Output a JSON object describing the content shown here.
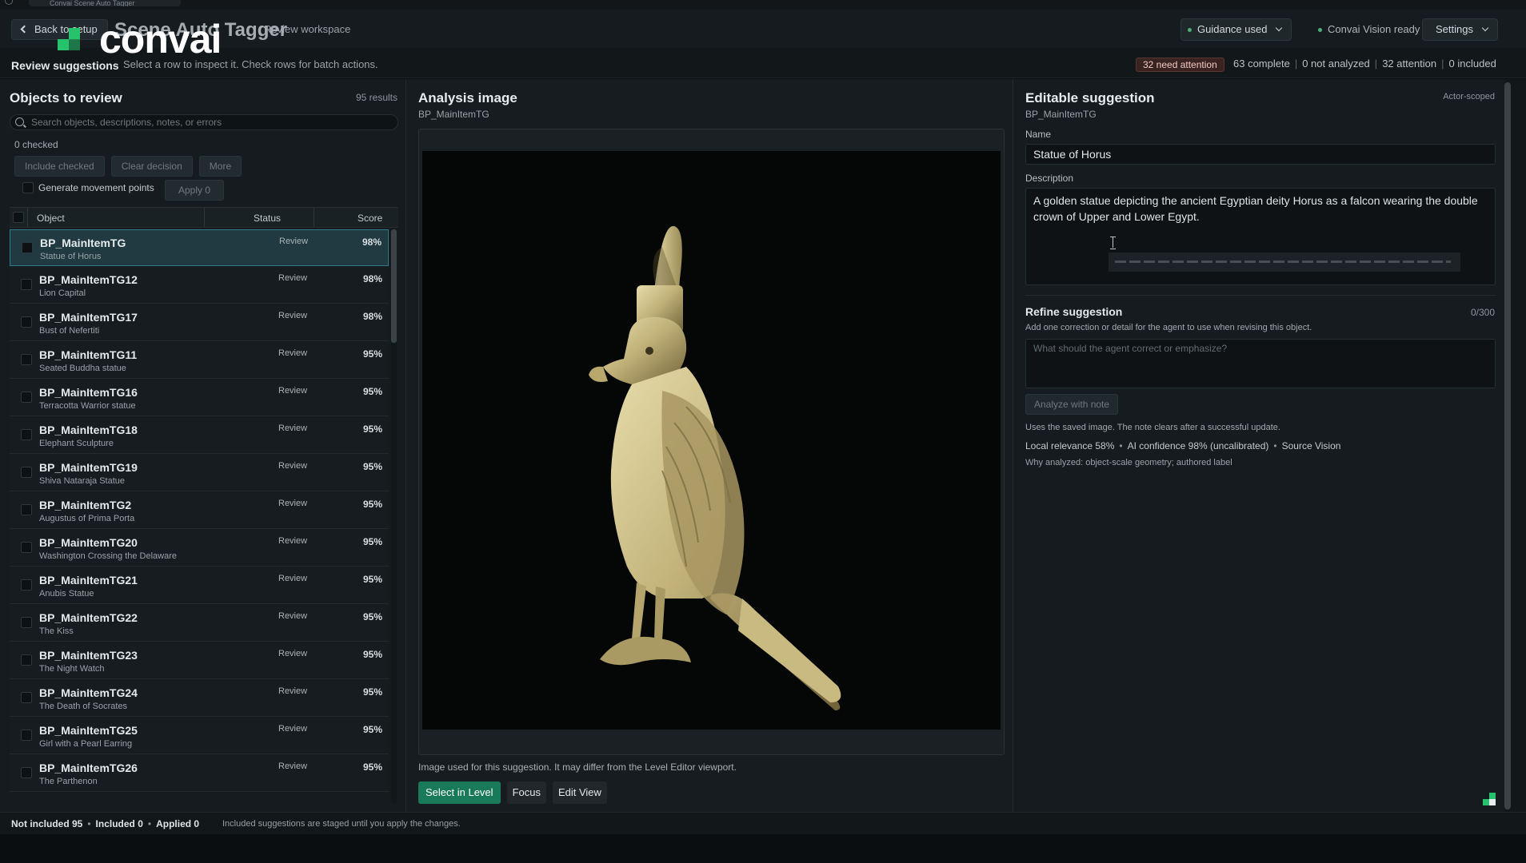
{
  "os": {
    "tab_label": "Convai Scene Auto Tagger"
  },
  "header": {
    "back_label": "Back to setup",
    "logo_word": "convai",
    "app_title": "Scene Auto Tagger",
    "app_subtitle": "Review workspace",
    "guidance_label": "Guidance used",
    "vision_status": "Convai Vision ready",
    "settings_label": "Settings"
  },
  "subheader": {
    "title": "Review suggestions",
    "hint": "Select a row to inspect it. Check rows for batch actions.",
    "attention_badge": "32 need attention",
    "stats": {
      "complete": "63 complete",
      "not_analyzed": "0 not analyzed",
      "attention": "32 attention",
      "included": "0 included"
    }
  },
  "left": {
    "title": "Objects to review",
    "result_count": "95 results",
    "search_placeholder": "Search objects, descriptions, notes, or errors",
    "checked_count": "0 checked",
    "buttons": {
      "include_checked": "Include checked",
      "clear_decision": "Clear decision",
      "more": "More",
      "apply": "Apply 0"
    },
    "generate_label": "Generate movement points",
    "columns": {
      "object": "Object",
      "status": "Status",
      "score": "Score"
    },
    "rows": [
      {
        "name": "BP_MainItemTG",
        "desc": "Statue of Horus",
        "status": "Review",
        "score": "98%"
      },
      {
        "name": "BP_MainItemTG12",
        "desc": "Lion Capital",
        "status": "Review",
        "score": "98%"
      },
      {
        "name": "BP_MainItemTG17",
        "desc": "Bust of Nefertiti",
        "status": "Review",
        "score": "98%"
      },
      {
        "name": "BP_MainItemTG11",
        "desc": "Seated Buddha statue",
        "status": "Review",
        "score": "95%"
      },
      {
        "name": "BP_MainItemTG16",
        "desc": "Terracotta Warrior statue",
        "status": "Review",
        "score": "95%"
      },
      {
        "name": "BP_MainItemTG18",
        "desc": "Elephant Sculpture",
        "status": "Review",
        "score": "95%"
      },
      {
        "name": "BP_MainItemTG19",
        "desc": "Shiva Nataraja Statue",
        "status": "Review",
        "score": "95%"
      },
      {
        "name": "BP_MainItemTG2",
        "desc": "Augustus of Prima Porta",
        "status": "Review",
        "score": "95%"
      },
      {
        "name": "BP_MainItemTG20",
        "desc": "Washington Crossing the Delaware",
        "status": "Review",
        "score": "95%"
      },
      {
        "name": "BP_MainItemTG21",
        "desc": "Anubis Statue",
        "status": "Review",
        "score": "95%"
      },
      {
        "name": "BP_MainItemTG22",
        "desc": "The Kiss",
        "status": "Review",
        "score": "95%"
      },
      {
        "name": "BP_MainItemTG23",
        "desc": "The Night Watch",
        "status": "Review",
        "score": "95%"
      },
      {
        "name": "BP_MainItemTG24",
        "desc": "The Death of Socrates",
        "status": "Review",
        "score": "95%"
      },
      {
        "name": "BP_MainItemTG25",
        "desc": "Girl with a Pearl Earring",
        "status": "Review",
        "score": "95%"
      },
      {
        "name": "BP_MainItemTG26",
        "desc": "The Parthenon",
        "status": "Review",
        "score": "95%"
      }
    ]
  },
  "center": {
    "title": "Analysis image",
    "object_id": "BP_MainItemTG",
    "note": "Image used for this suggestion. It may differ from the Level Editor viewport.",
    "actions": {
      "select": "Select in Level",
      "focus": "Focus",
      "edit_view": "Edit View"
    }
  },
  "right": {
    "title": "Editable suggestion",
    "scope": "Actor-scoped",
    "object_id": "BP_MainItemTG",
    "name_label": "Name",
    "name_value": "Statue of Horus",
    "description_label": "Description",
    "description_value": "A golden statue depicting the ancient Egyptian deity Horus as a falcon wearing the double crown of Upper and Lower Egypt.",
    "refine_title": "Refine suggestion",
    "refine_count": "0/300",
    "refine_hint": "Add one correction or detail for the agent to use when revising this object.",
    "refine_placeholder": "What should the agent correct or emphasize?",
    "analyze_label": "Analyze with note",
    "saved_note": "Uses the saved image. The note clears after a successful update.",
    "meta": {
      "relevance": "Local relevance 58%",
      "confidence": "AI confidence 98% (uncalibrated)",
      "source": "Source Vision"
    },
    "why": "Why analyzed: object-scale geometry; authored label"
  },
  "footer": {
    "not_included": "Not included 95",
    "included": "Included 0",
    "applied": "Applied 0",
    "note": "Included suggestions are staged until you apply the changes."
  },
  "colors": {
    "accent": "#187a58",
    "brand_green": "#27c36c",
    "selected_row": "#213a42",
    "attention": "#3a2421"
  }
}
